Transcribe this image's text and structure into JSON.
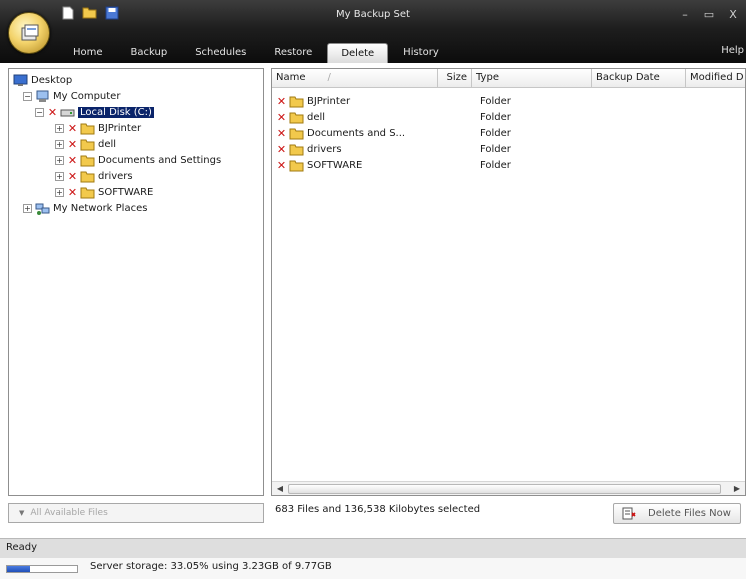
{
  "window": {
    "title": "My Backup Set",
    "controls": {
      "minimize": "–",
      "maximize": "▭",
      "close": "X"
    },
    "help": "Help"
  },
  "quick_access": [
    "new-document-icon",
    "open-folder-icon",
    "save-disk-icon"
  ],
  "tabs": [
    {
      "label": "Home",
      "active": false
    },
    {
      "label": "Backup",
      "active": false
    },
    {
      "label": "Schedules",
      "active": false
    },
    {
      "label": "Restore",
      "active": false
    },
    {
      "label": "Delete",
      "active": true
    },
    {
      "label": "History",
      "active": false
    }
  ],
  "tree": {
    "desktop": "Desktop",
    "my_computer": "My Computer",
    "local_disk": "Local Disk (C:)",
    "folders": [
      "BJPrinter",
      "dell",
      "Documents and Settings",
      "drivers",
      "SOFTWARE"
    ],
    "network": "My Network Places"
  },
  "list": {
    "columns": {
      "name": "Name",
      "size": "Size",
      "type": "Type",
      "backup_date": "Backup Date",
      "modified_date": "Modified D"
    },
    "rows": [
      {
        "name": "BJPrinter",
        "size": "",
        "type": "Folder"
      },
      {
        "name": "dell",
        "size": "",
        "type": "Folder"
      },
      {
        "name": "Documents and S...",
        "size": "",
        "type": "Folder"
      },
      {
        "name": "drivers",
        "size": "",
        "type": "Folder"
      },
      {
        "name": "SOFTWARE",
        "size": "",
        "type": "Folder"
      }
    ]
  },
  "footer": {
    "filter_label": "All Available Files",
    "selection_summary": "683 Files and 136,538 Kilobytes selected",
    "delete_button": "Delete Files Now",
    "status": "Ready",
    "storage_text": "Server storage: 33.05% using 3.23GB of 9.77GB",
    "storage_percent": 33.05
  },
  "colors": {
    "delete_mark": "#cc1414",
    "selection": "#0a246a",
    "storage_fill": "#1f4fb8"
  }
}
